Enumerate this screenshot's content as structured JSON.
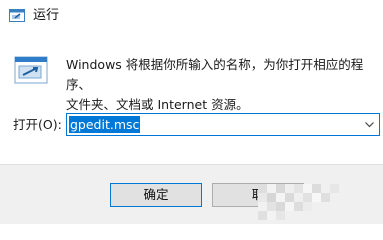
{
  "window": {
    "title": "运行",
    "title_icon": "run-icon"
  },
  "content": {
    "icon": "run-dialog-icon",
    "description_line1": "Windows 将根据你所输入的名称，为你打开相应的程序、",
    "description_line2": "文件夹、文档或 Internet 资源。",
    "open_label": "打开(O):",
    "open_value": "gpedit.msc"
  },
  "buttons": {
    "ok_label": "确定",
    "cancel_label": "取"
  },
  "colors": {
    "accent": "#0078d7",
    "footer_bg": "#f0f0f0",
    "button_bg": "#e1e1e1"
  }
}
